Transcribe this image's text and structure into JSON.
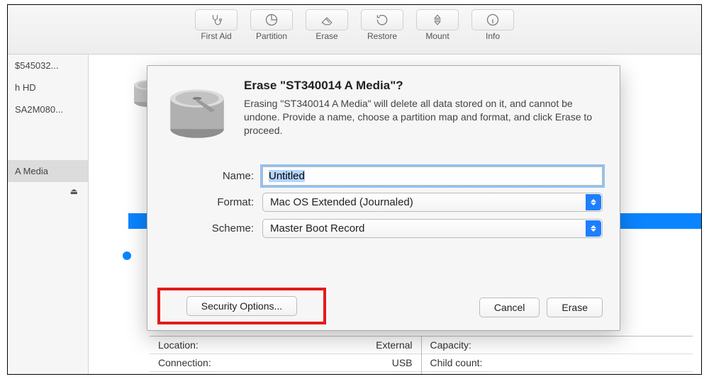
{
  "toolbar": {
    "items": [
      {
        "label": "First Aid"
      },
      {
        "label": "Partition"
      },
      {
        "label": "Erase"
      },
      {
        "label": "Restore"
      },
      {
        "label": "Mount"
      },
      {
        "label": "Info"
      }
    ]
  },
  "sidebar": {
    "items": [
      {
        "label": "$545032..."
      },
      {
        "label": "h HD"
      },
      {
        "label": "SA2M080..."
      },
      {
        "label": "A Media",
        "selected": true
      }
    ]
  },
  "dialog": {
    "title": "Erase \"ST340014 A Media\"?",
    "body": "Erasing \"ST340014 A Media\" will delete all data stored on it, and cannot be undone. Provide a name, choose a partition map and format, and click Erase to proceed.",
    "name_label": "Name:",
    "name_value": "Untitled",
    "format_label": "Format:",
    "format_value": "Mac OS Extended (Journaled)",
    "scheme_label": "Scheme:",
    "scheme_value": "Master Boot Record",
    "security_label": "Security Options...",
    "cancel_label": "Cancel",
    "erase_label": "Erase"
  },
  "details": {
    "left": {
      "location_label": "Location:",
      "location_value": "External",
      "connection_label": "Connection:",
      "connection_value": "USB"
    },
    "right": {
      "capacity_label": "Capacity:",
      "child_label": "Child count:"
    }
  }
}
